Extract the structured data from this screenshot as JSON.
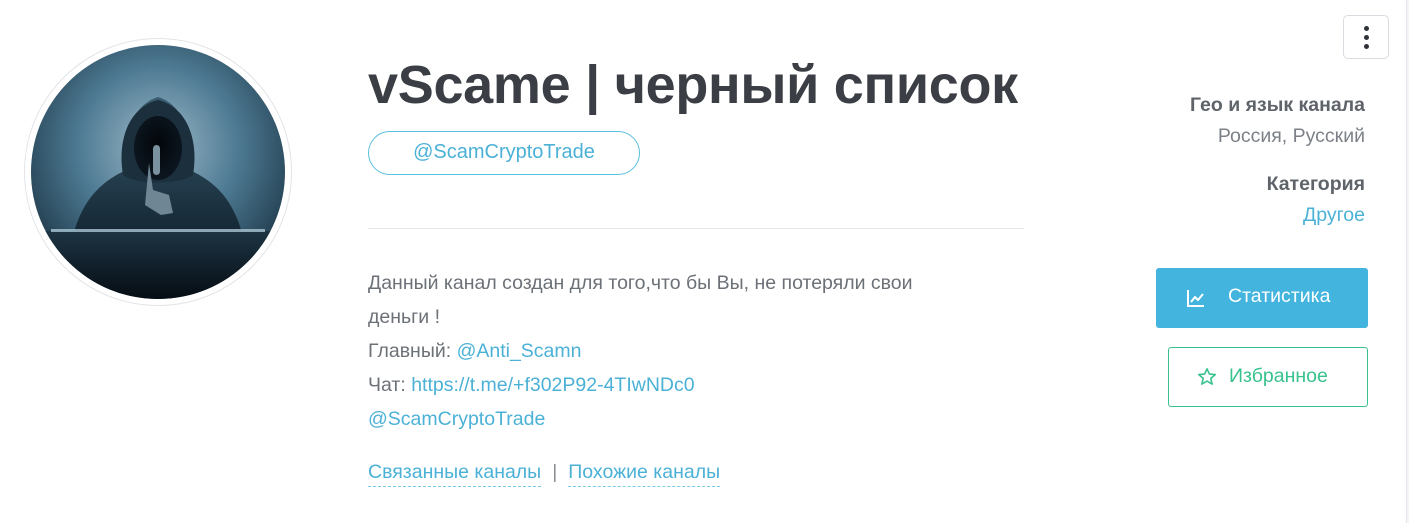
{
  "channel": {
    "title": "vScame | черный список",
    "handle": "@ScamCryptoTrade",
    "avatar_icon": "hooded-hacker-avatar"
  },
  "description": {
    "line1": "Данный канал создан для того,что бы Вы, не потеряли свои",
    "line2": "деньги !",
    "main_label": "Главный: ",
    "main_link": "@Anti_Scamn",
    "chat_label": "Чат: ",
    "chat_link": "https://t.me/+f302P92-4TIwNDc0",
    "handle_link": "@ScamCryptoTrade"
  },
  "related": {
    "linked_label": "Связанные каналы",
    "separator": "|",
    "similar_label": "Похожие каналы"
  },
  "sidebar": {
    "geo_label": "Гео и язык канала",
    "geo_value": "Россия, Русский",
    "category_label": "Категория",
    "category_value": "Другое"
  },
  "actions": {
    "stats_label": "Статистика",
    "stats_icon": "line-chart-icon",
    "favorite_label": "Избранное",
    "favorite_icon": "star-outline-icon",
    "menu_icon": "vertical-dots-icon"
  },
  "colors": {
    "link": "#4bb1d6",
    "stats_button": "#42b4de",
    "favorite_accent": "#38c28d",
    "title": "#3b3f45"
  }
}
